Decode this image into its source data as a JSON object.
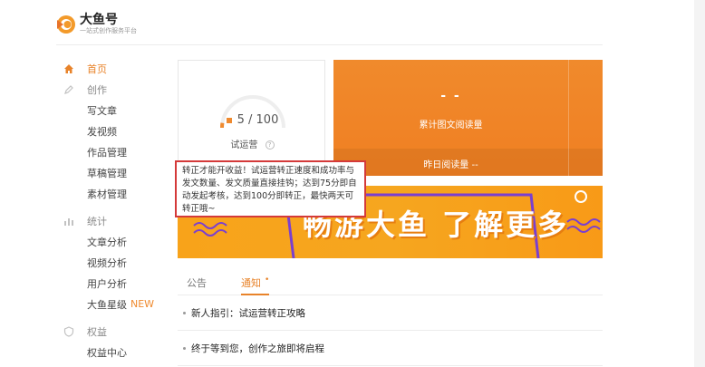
{
  "brand": {
    "title": "大鱼号",
    "subtitle": "一站式创作服务平台"
  },
  "sidebar": {
    "home": "首页",
    "create": {
      "label": "创作",
      "items": [
        "写文章",
        "发视频",
        "作品管理",
        "草稿管理",
        "素材管理"
      ]
    },
    "stats": {
      "label": "统计",
      "items": [
        "文章分析",
        "视频分析",
        "用户分析",
        "大鱼星级"
      ],
      "new_badge": "NEW"
    },
    "rights": {
      "label": "权益",
      "items": [
        "权益中心"
      ]
    }
  },
  "score_card": {
    "score": "5 / 100",
    "score_fraction": 0.05,
    "status": "试运营",
    "help": "?"
  },
  "orange_stats": {
    "value": "- -",
    "cumulative_label": "累计图文阅读量",
    "yesterday_label": "昨日阅读量 --"
  },
  "banner": {
    "text": "畅游大鱼 了解更多"
  },
  "tooltip": {
    "text": "转正才能开收益！试运营转正速度和成功率与发文数量、发文质量直接挂钩；达到75分即自动发起考核，达到100分即转正，最快两天可转正哦~"
  },
  "tabs": {
    "announcement": "公告",
    "notification": "通知",
    "dot": "•"
  },
  "notices": [
    "新人指引：试运营转正攻略",
    "终于等到您，创作之旅即将启程"
  ],
  "colors": {
    "accent": "#e8832a",
    "orange": "#f08a2c",
    "tooltip_border": "#d43a3a"
  }
}
